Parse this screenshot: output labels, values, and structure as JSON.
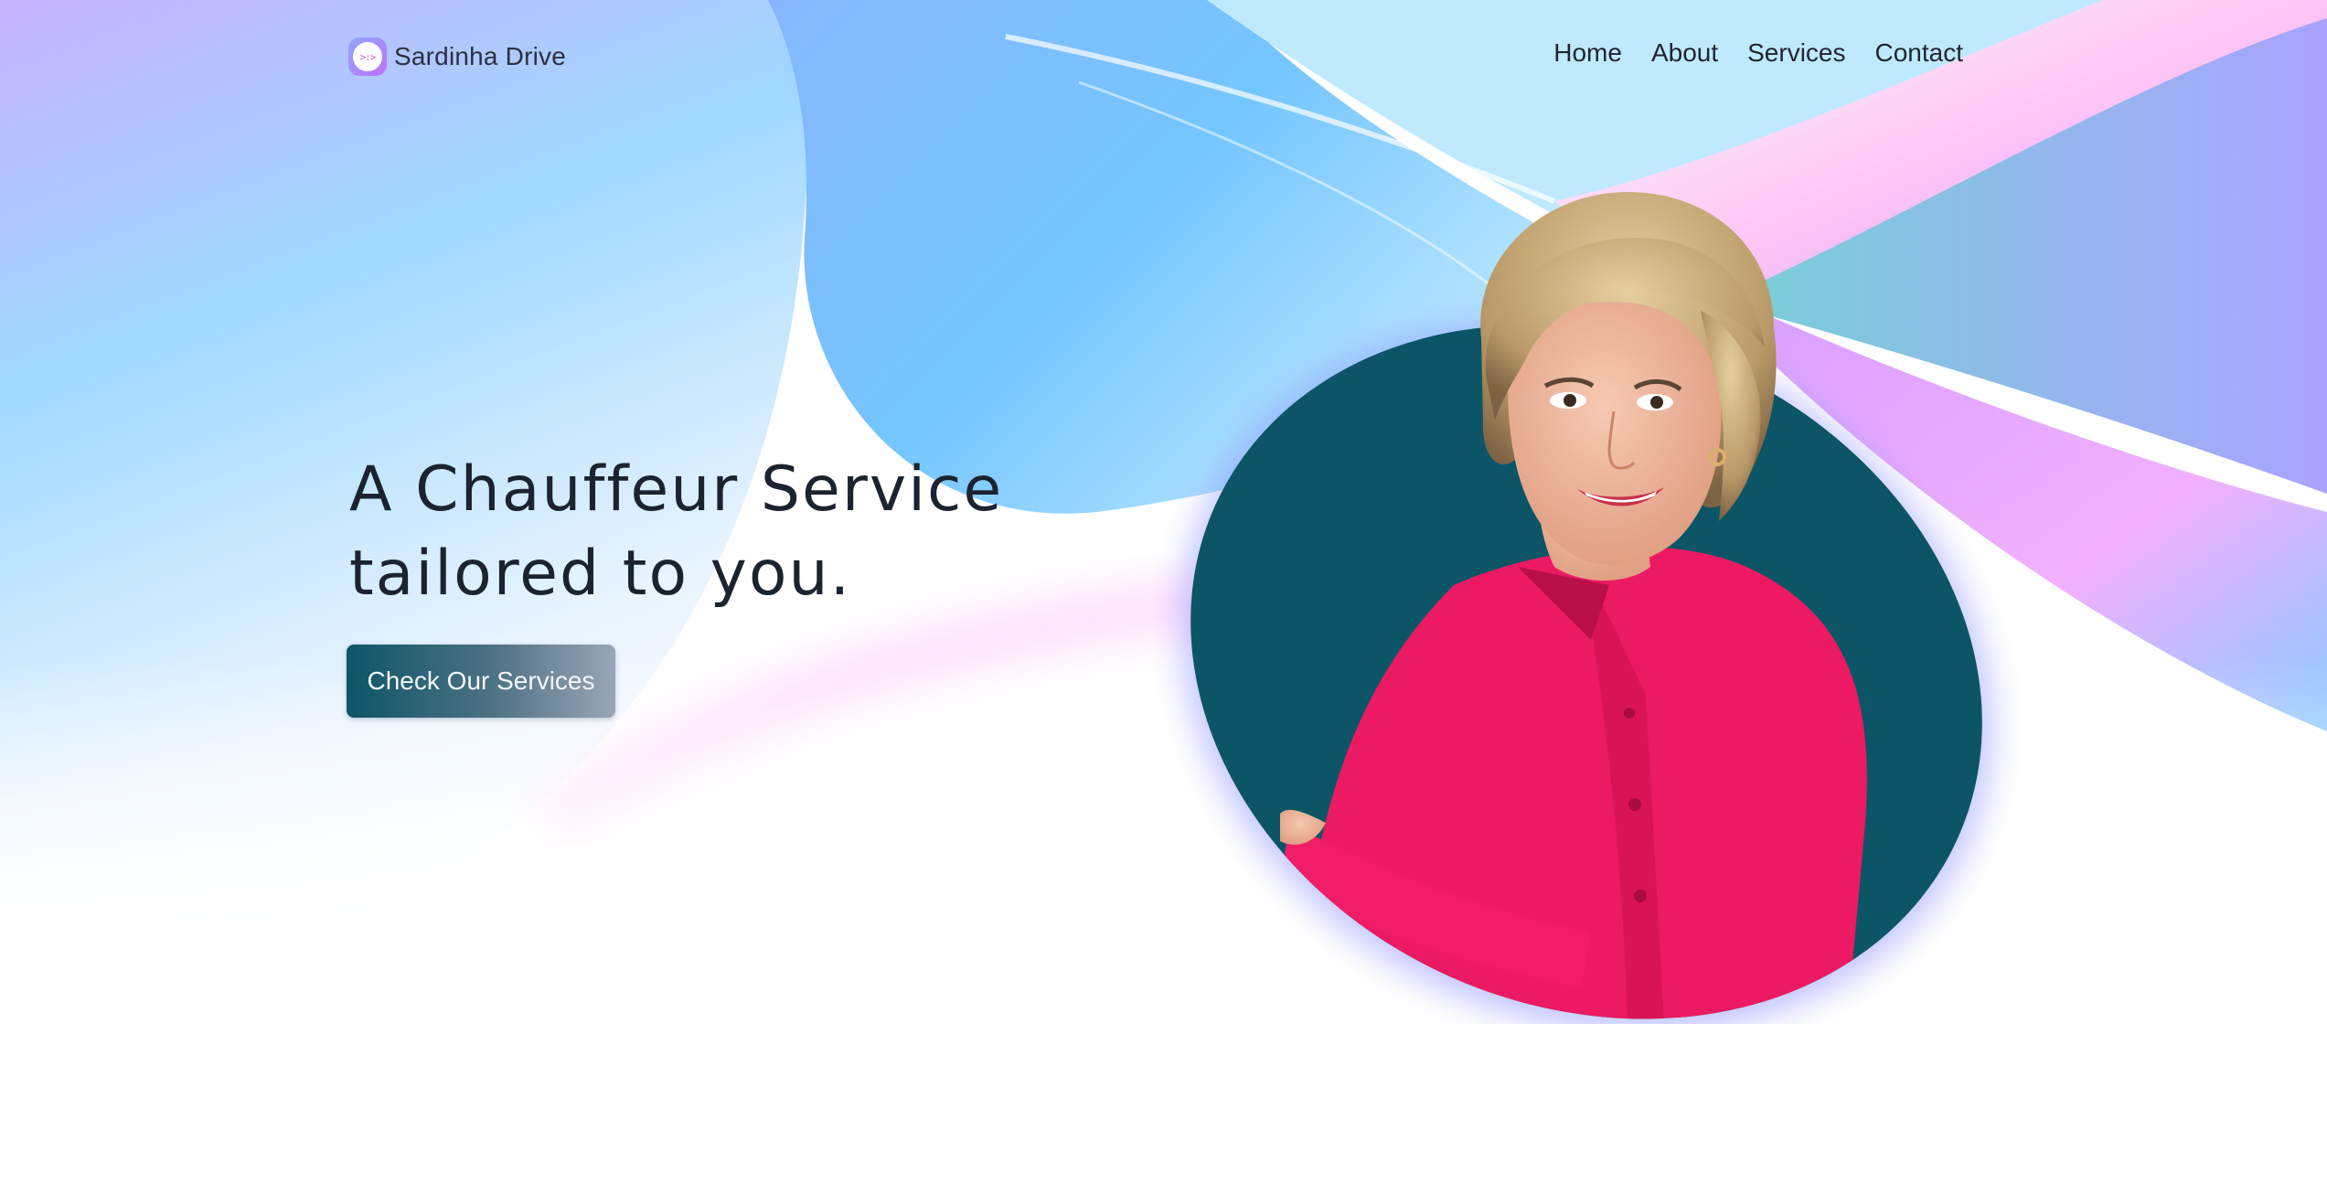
{
  "header": {
    "brand": "Sardinha Drive",
    "logo_glyph": ">:>",
    "nav": [
      "Home",
      "About",
      "Services",
      "Contact"
    ]
  },
  "hero": {
    "headline": "A Chauffeur Service tailored to you.",
    "cta_label": "Check Our Services",
    "image_alt": "Portrait of a smiling woman with short blonde hair in a pink shirt"
  },
  "colors": {
    "accent": "#0c5567",
    "cta_gradient_end": "#9aa6b8",
    "shirt": "#e8175d",
    "background_blue": "#7fc8ff",
    "background_violet": "#b7a3ff",
    "background_pink": "#f3a8ff"
  }
}
